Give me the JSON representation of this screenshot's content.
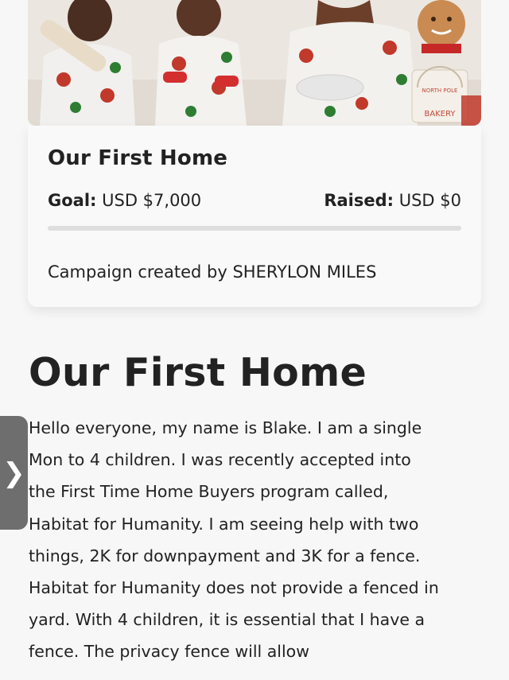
{
  "hero": {
    "sign_lines": [
      "NORTH POLE",
      "BAKERY"
    ]
  },
  "campaign": {
    "title": "Our First Home",
    "goal_label": "Goal:",
    "goal_value": "USD $7,000",
    "raised_label": "Raised:",
    "raised_value": "USD $0",
    "progress_fraction": 0,
    "creator_prefix": "Campaign created by",
    "creator_name": "SHERYLON MILES"
  },
  "story": {
    "heading": "Our First Home",
    "body": "Hello everyone, my name is Blake. I am a single Mon to 4 children. I was recently accepted into the First Time Home Buyers program called, Habitat for Humanity. I am seeing help with two things, 2K for downpayment and 3K for a fence. Habitat for Humanity does not provide a fenced in yard. With 4 children, it is essential that I have a fence. The privacy fence will allow"
  },
  "side_tab": {
    "icon": "chevron-right-icon",
    "glyph": "❯"
  },
  "colors": {
    "text": "#222222",
    "progress_track": "#dedede",
    "side_tab": "#6e6e6e"
  }
}
